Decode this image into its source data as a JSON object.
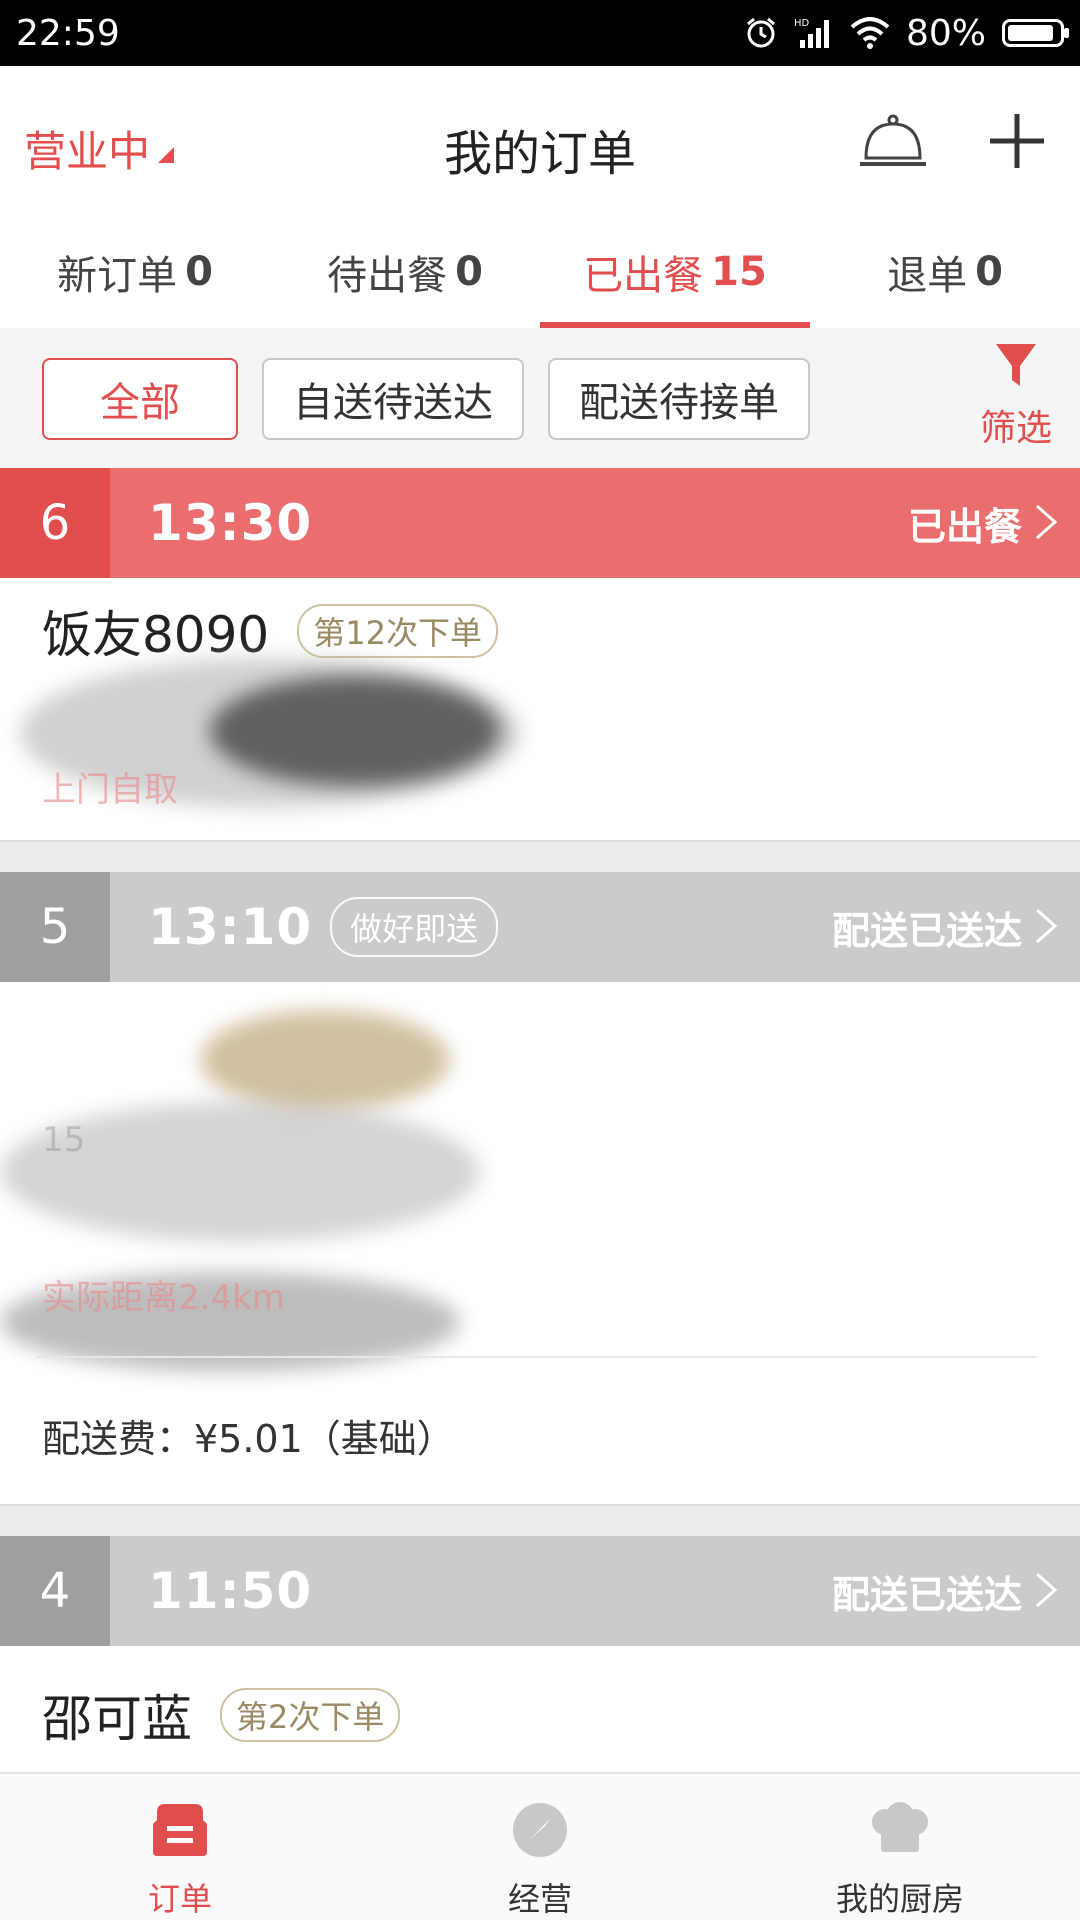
{
  "status_bar": {
    "time": "22:59",
    "battery": "80%"
  },
  "header": {
    "business_status": "营业中",
    "title": "我的订单"
  },
  "tabs": [
    {
      "label": "新订单",
      "count": "0"
    },
    {
      "label": "待出餐",
      "count": "0"
    },
    {
      "label": "已出餐",
      "count": "15"
    },
    {
      "label": "退单",
      "count": "0"
    }
  ],
  "filters": {
    "chips": [
      "全部",
      "自送待送达",
      "配送待接单"
    ],
    "filter_label": "筛选"
  },
  "orders": [
    {
      "number": "6",
      "time": "13:30",
      "state": "已出餐",
      "customer": "饭友8090",
      "order_count_tag": "第12次下单",
      "faint_text": "上门自取"
    },
    {
      "number": "5",
      "time": "13:10",
      "tag": "做好即送",
      "state": "配送已送达",
      "faint_text": "实际距离2.4km",
      "faint_number": "15",
      "fee": "配送费：¥5.01（基础）"
    },
    {
      "number": "4",
      "time": "11:50",
      "state": "配送已送达",
      "customer": "邵可蓝",
      "order_count_tag": "第2次下单"
    }
  ],
  "bottom_nav": [
    {
      "label": "订单",
      "icon": "order-icon"
    },
    {
      "label": "经营",
      "icon": "compass-icon"
    },
    {
      "label": "我的厨房",
      "icon": "chef-hat-icon"
    }
  ],
  "colors": {
    "accent": "#e24e4e",
    "gray_header": "#cbcbcb"
  }
}
